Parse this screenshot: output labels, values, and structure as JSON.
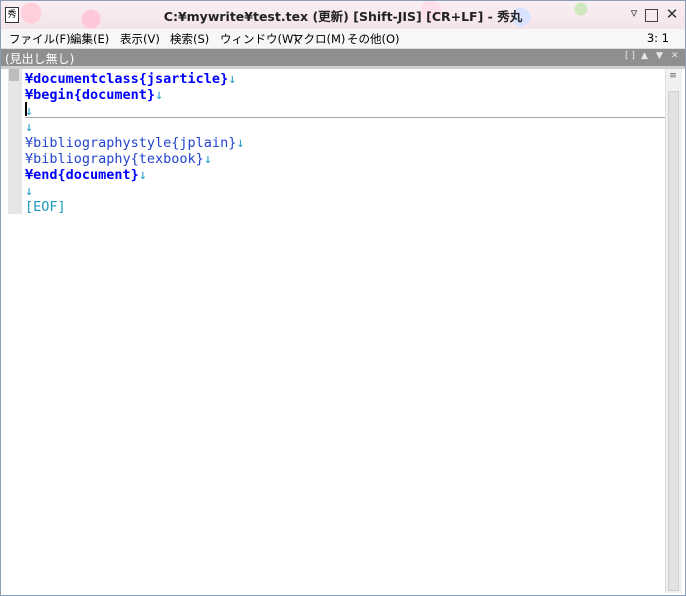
{
  "window": {
    "title": "C:¥mywrite¥test.tex (更新) [Shift-JIS] [CR+LF] - 秀丸",
    "app_icon_glyph": "秀"
  },
  "menu": {
    "items": [
      "ファイル(F)",
      "編集(E)",
      "表示(V)",
      "検索(S)",
      "ウィンドウ(W)",
      "マクロ(M)",
      "その他(O)"
    ],
    "position": "3: 1"
  },
  "header": {
    "label": "(見出し無し)"
  },
  "editor": {
    "lines": [
      {
        "text": "¥documentclass{jsarticle}",
        "eol": "↓",
        "style": "blue-bold"
      },
      {
        "text": "¥begin{document}",
        "eol": "↓",
        "style": "blue-bold"
      },
      {
        "text": "",
        "eol": "↓",
        "style": "blue"
      },
      {
        "text": "",
        "eol": "↓",
        "style": "blue"
      },
      {
        "text": "¥bibliographystyle{jplain}",
        "eol": "↓",
        "style": "blue"
      },
      {
        "text": "¥bibliography{texbook}",
        "eol": "↓",
        "style": "blue"
      },
      {
        "text": "¥end{document}",
        "eol": "↓",
        "style": "blue-bold"
      },
      {
        "text": "",
        "eol": "↓",
        "style": "blue"
      },
      {
        "text": "[EOF]",
        "eol": "",
        "style": "eof"
      }
    ]
  }
}
